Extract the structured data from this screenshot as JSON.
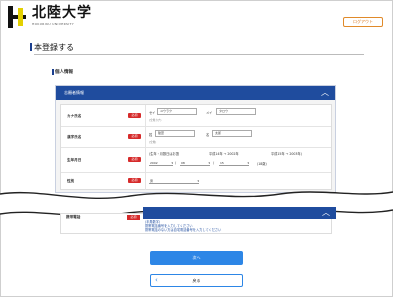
{
  "header": {
    "logo_text": "北陸大学",
    "logo_sub": "HOKURIKU UNIVERSITY",
    "logout_label": "ログアウト"
  },
  "page": {
    "title": "本登録する",
    "section_label": "個人情報"
  },
  "panel": {
    "title": "志願者情報",
    "required_label": "必須",
    "rows": {
      "kana": {
        "label": "カナ氏名",
        "sei_label": "セイ",
        "sei_value": "ユウラク",
        "mei_label": "メイ",
        "mei_value": "タロウ",
        "note": "(全角カナ)"
      },
      "kanji": {
        "label": "漢字氏名",
        "sei_label": "姓",
        "sei_value": "陸葉",
        "mei_label": "名",
        "mei_value": "太郎",
        "note": "(全角)"
      },
      "birth": {
        "label": "生年月日",
        "hint": "(生年・月数日はお選",
        "era1": "平成14年 → 2002年",
        "era2": "平成15年 → 2003年)",
        "year": "2002",
        "month": "08",
        "day": "15",
        "age": "(18歳)"
      },
      "gender": {
        "label": "性別",
        "value": "男"
      }
    }
  },
  "lower": {
    "label": "携帯電話",
    "required_label": "必須",
    "note_line1": "(半角数字)",
    "note_line2": "携帯電話番号を入力してください",
    "note_line3": "携帯電話のない方は自宅電話番号を入力してください"
  },
  "buttons": {
    "next": "次へ",
    "back": "戻る"
  },
  "colors": {
    "brand_blue": "#1f4c9e",
    "button_blue": "#2d86e6",
    "required_red": "#d62b2b",
    "logout_orange": "#e08a2a"
  }
}
